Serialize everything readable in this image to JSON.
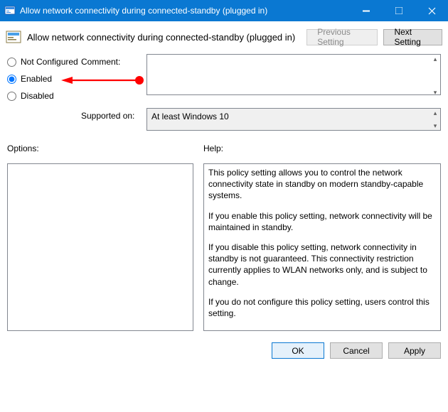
{
  "window": {
    "title": "Allow network connectivity during connected-standby (plugged in)"
  },
  "header": {
    "title": "Allow network connectivity during connected-standby (plugged in)",
    "prev_button": "Previous Setting",
    "next_button": "Next Setting"
  },
  "state": {
    "not_configured_label": "Not Configured",
    "enabled_label": "Enabled",
    "disabled_label": "Disabled",
    "selected": "enabled"
  },
  "comment": {
    "label": "Comment:",
    "value": ""
  },
  "supported": {
    "label": "Supported on:",
    "value": "At least Windows 10"
  },
  "options": {
    "label": "Options:",
    "value": ""
  },
  "help": {
    "label": "Help:",
    "p1": "This policy setting allows you to control the network connectivity state in standby on modern standby-capable systems.",
    "p2": "If you enable this policy setting, network connectivity will be maintained in standby.",
    "p3": "If you disable this policy setting, network connectivity in standby is not guaranteed. This connectivity restriction currently applies to WLAN networks only, and is subject to change.",
    "p4": "If you do not configure this policy setting, users control this setting."
  },
  "footer": {
    "ok": "OK",
    "cancel": "Cancel",
    "apply": "Apply"
  },
  "annotation": {
    "color": "#ff0000"
  }
}
